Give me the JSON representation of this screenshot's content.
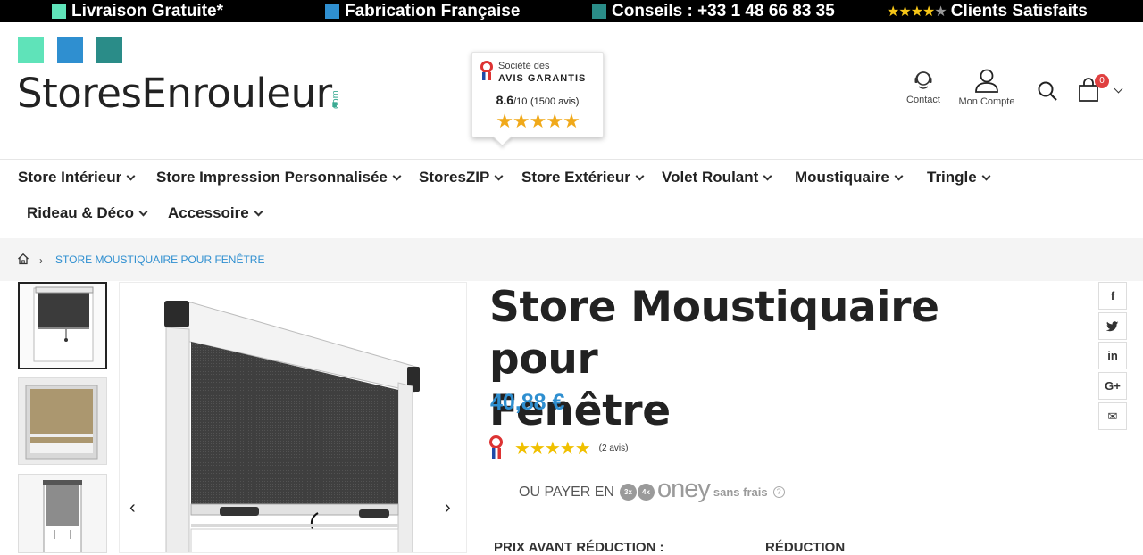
{
  "topbar": {
    "items": [
      {
        "label": "Livraison Gratuite*",
        "color": "#5fe3b9"
      },
      {
        "label": "Fabrication Française",
        "color": "#2f8fd0"
      },
      {
        "label": "Conseils : +33 1 48 66 83 35",
        "color": "#2a8c88"
      },
      {
        "label": "Clients Satisfaits",
        "rating": 4
      }
    ]
  },
  "logo": {
    "name": "StoresEnrouleur",
    "dot": ".",
    "suffix": "com",
    "square_colors": [
      "#5fe3b9",
      "#2f8fd0",
      "#2a8c88"
    ]
  },
  "avis": {
    "line1": "Société des",
    "line2": "AVIS GARANTIS",
    "score": "8.6",
    "scale": "/10",
    "count": "(1500 avis)",
    "stars": "★★★★★"
  },
  "header": {
    "contact_label": "Contact",
    "account_label": "Mon Compte",
    "cart_count": "0"
  },
  "nav": {
    "items": [
      "Store Intérieur",
      "Store Impression Personnalisée",
      "StoresZIP",
      "Store Extérieur",
      "Volet Roulant",
      "Moustiquaire",
      "Tringle",
      "Rideau & Déco",
      "Accessoire"
    ]
  },
  "breadcrumb": {
    "separator": "›",
    "current": "STORE MOUSTIQUAIRE POUR FENÊTRE"
  },
  "gallery": {
    "prev": "‹",
    "next": "›"
  },
  "product": {
    "title_line1": "Store Moustiquaire pour",
    "title_line2": "Fenêtre",
    "price": "40,88 €",
    "stars": "★★★★★",
    "review_count": "(2 avis)",
    "pay_prefix": "OU PAYER EN",
    "pay_3x": "3x",
    "pay_4x": "4x",
    "pay_brand": "oney",
    "pay_suffix": "sans frais",
    "pay_help": "?",
    "price_before_label": "PRIX AVANT RÉDUCTION :",
    "discount_label": "RÉDUCTION"
  },
  "share": {
    "icons": [
      "facebook-icon",
      "twitter-icon",
      "linkedin-icon",
      "google-plus-icon",
      "email-icon"
    ],
    "labels": [
      "f",
      "🐦",
      "in",
      "G+",
      "✉"
    ]
  }
}
